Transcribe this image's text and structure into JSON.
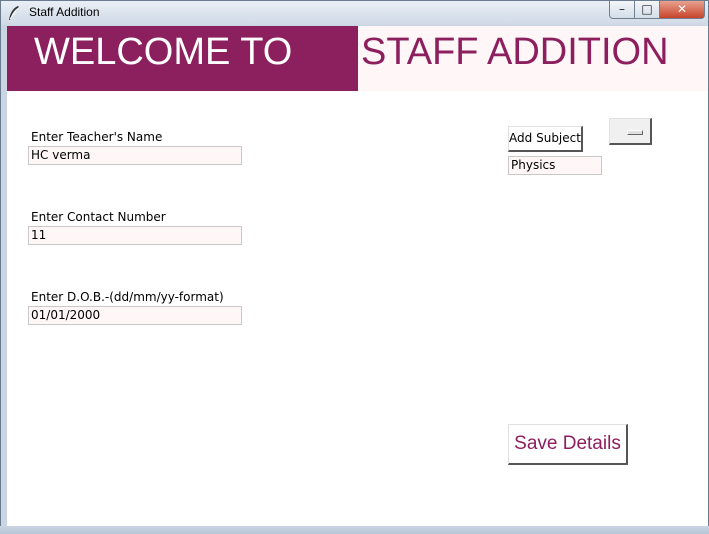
{
  "window": {
    "title": "Staff Addition",
    "minimize_glyph": "–",
    "maximize_glyph": "□",
    "close_glyph": "✕"
  },
  "banner": {
    "left_text": "WELCOME TO",
    "right_text": "STAFF ADDITION",
    "left_bg": "#8c1f5e",
    "right_fg": "#8c1f5e"
  },
  "form": {
    "teacher_name_label": "Enter Teacher's Name",
    "teacher_name_value": "HC verma",
    "contact_label": "Enter Contact Number",
    "contact_value": "11",
    "dob_label": "Enter D.O.B.-(dd/mm/yy-format)",
    "dob_value": "01/01/2000"
  },
  "subject": {
    "add_button_label": "Add Subject",
    "subject_value": "Physics"
  },
  "actions": {
    "save_label": "Save Details"
  },
  "icons": {
    "app": "feather-icon"
  }
}
